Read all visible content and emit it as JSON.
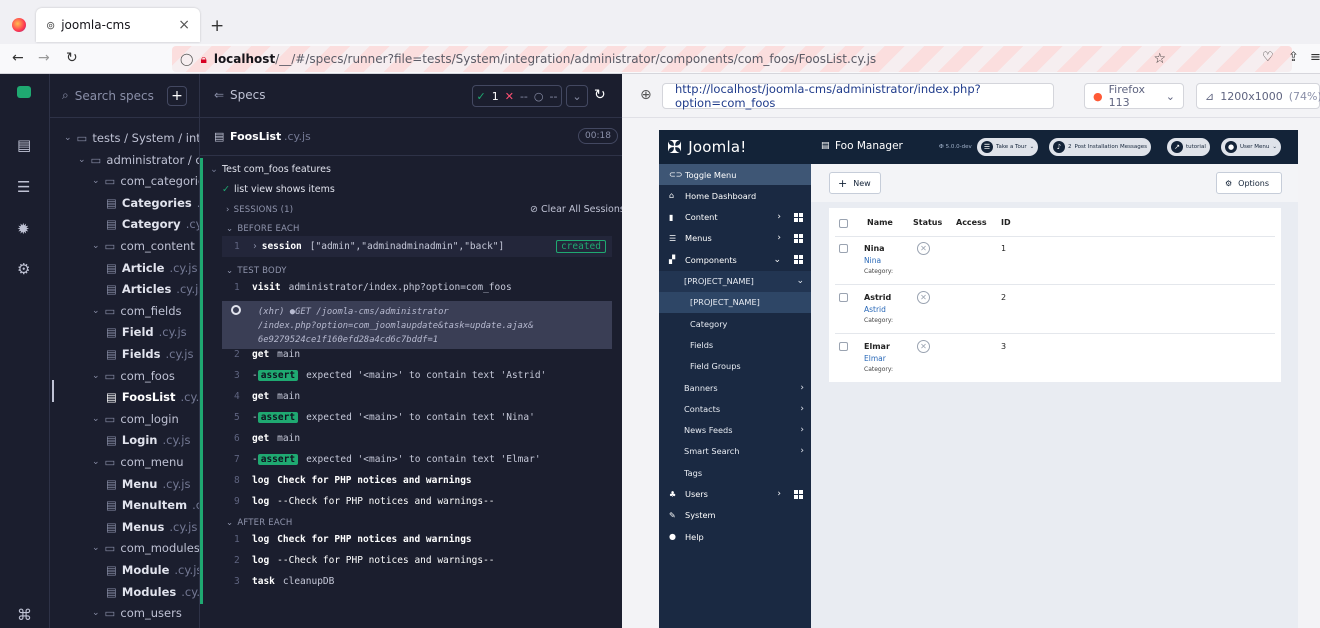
{
  "browser": {
    "tab_title": "joomla-cms",
    "tab_close": "×",
    "new_tab": "+",
    "url_host": "localhost",
    "url_path": "/__/#/specs/runner?file=tests/System/integration/administrator/components/com_foos/FoosList.cy.js"
  },
  "specs_panel": {
    "search_placeholder": "Search specs",
    "add_label": "+",
    "tree": [
      {
        "label": "tests / System / inte",
        "kind": "folder",
        "level": 0
      },
      {
        "label": "administrator / co",
        "kind": "folder",
        "level": 1
      },
      {
        "label": "com_categories",
        "kind": "folder",
        "level": 2
      },
      {
        "label": "Categories",
        "ext": ".cy.js",
        "kind": "file",
        "level": 3
      },
      {
        "label": "Category",
        "ext": ".cy.js",
        "kind": "file",
        "level": 3
      },
      {
        "label": "com_content",
        "kind": "folder",
        "level": 2
      },
      {
        "label": "Article",
        "ext": ".cy.js",
        "kind": "file",
        "level": 3
      },
      {
        "label": "Articles",
        "ext": ".cy.js",
        "kind": "file",
        "level": 3
      },
      {
        "label": "com_fields",
        "kind": "folder",
        "level": 2
      },
      {
        "label": "Field",
        "ext": ".cy.js",
        "kind": "file",
        "level": 3
      },
      {
        "label": "Fields",
        "ext": ".cy.js",
        "kind": "file",
        "level": 3
      },
      {
        "label": "com_foos",
        "kind": "folder",
        "level": 2
      },
      {
        "label": "FoosList",
        "ext": ".cy.js",
        "kind": "file",
        "level": 3,
        "active": true
      },
      {
        "label": "com_login",
        "kind": "folder",
        "level": 2
      },
      {
        "label": "Login",
        "ext": ".cy.js",
        "kind": "file",
        "level": 3
      },
      {
        "label": "com_menu",
        "kind": "folder",
        "level": 2
      },
      {
        "label": "Menu",
        "ext": ".cy.js",
        "kind": "file",
        "level": 3
      },
      {
        "label": "MenuItem",
        "ext": ".cy.js",
        "kind": "file",
        "level": 3
      },
      {
        "label": "Menus",
        "ext": ".cy.js",
        "kind": "file",
        "level": 3
      },
      {
        "label": "com_modules",
        "kind": "folder",
        "level": 2
      },
      {
        "label": "Module",
        "ext": ".cy.js",
        "kind": "file",
        "level": 3
      },
      {
        "label": "Modules",
        "ext": ".cy.js",
        "kind": "file",
        "level": 3
      },
      {
        "label": "com_users",
        "kind": "folder",
        "level": 2
      }
    ]
  },
  "reporter": {
    "title": "Specs",
    "passed": "1",
    "failed": "--",
    "pending": "--",
    "file_name": "FoosList",
    "file_ext": ".cy.js",
    "duration": "00:18",
    "suite_title": "Test com_foos features",
    "test_title": "list view shows items",
    "sessions_label": "SESSIONS (1)",
    "clear_sessions": "Clear All Sessions",
    "before_each": "BEFORE EACH",
    "session_num": "1",
    "session_cmd": "session",
    "session_args": "[\"admin\",\"adminadminadmin\",\"back\"]",
    "session_status": "created",
    "test_body": "TEST BODY",
    "cmds": [
      {
        "num": "1",
        "kw": "visit",
        "msg": "administrator/index.php?option=com_foos"
      },
      {
        "num": "2",
        "kw": "get",
        "msg": "main"
      },
      {
        "num": "3",
        "kw": "-assert",
        "msg": "expected '<main>' to contain text 'Astrid'"
      },
      {
        "num": "4",
        "kw": "get",
        "msg": "main"
      },
      {
        "num": "5",
        "kw": "-assert",
        "msg": "expected '<main>' to contain text 'Nina'"
      },
      {
        "num": "6",
        "kw": "get",
        "msg": "main"
      },
      {
        "num": "7",
        "kw": "-assert",
        "msg": "expected '<main>' to contain text 'Elmar'"
      },
      {
        "num": "8",
        "kw": "log",
        "msg": "Check for PHP notices and warnings"
      },
      {
        "num": "9",
        "kw": "log",
        "msg": "--Check for PHP notices and warnings--"
      }
    ],
    "xhr_line1": "(xhr)  ●GET /joomla-cms/administrator",
    "xhr_line2": "/index.php?option=com_joomlaupdate&task=update.ajax&",
    "xhr_line3": "6e9279524ce1f160efd28a4cd6c7bddf=1",
    "after_each": "AFTER EACH",
    "after_cmds": [
      {
        "num": "1",
        "kw": "log",
        "msg": "Check for PHP notices and warnings"
      },
      {
        "num": "2",
        "kw": "log",
        "msg": "--Check for PHP notices and warnings--"
      },
      {
        "num": "3",
        "kw": "task",
        "msg": "cleanupDB"
      }
    ]
  },
  "aut": {
    "url": "http://localhost/joomla-cms/administrator/index.php?option=com_foos",
    "browser": "Firefox 113",
    "viewport": "1200x1000",
    "zoom": "(74%)"
  },
  "joomla": {
    "logo": "Joomla!",
    "page_title": "Foo Manager",
    "version": "5.0.0-dev",
    "header_buttons": [
      "Take a Tour",
      "2",
      "Post Installation Messages",
      "tutorial",
      "User Menu"
    ],
    "menu": [
      {
        "label": "Toggle Menu",
        "kind": "top",
        "active": true
      },
      {
        "label": "Home Dashboard",
        "kind": "top"
      },
      {
        "label": "Content",
        "kind": "top",
        "chev": "›",
        "grid": true
      },
      {
        "label": "Menus",
        "kind": "top",
        "chev": "›",
        "grid": true
      },
      {
        "label": "Components",
        "kind": "top",
        "chev": "⌄",
        "grid": true
      },
      {
        "label": "[PROJECT_NAME]",
        "kind": "sub",
        "chev2": "⌄"
      },
      {
        "label": "[PROJECT_NAME]",
        "kind": "sub2"
      },
      {
        "label": "Category",
        "kind": "sub2"
      },
      {
        "label": "Fields",
        "kind": "sub2"
      },
      {
        "label": "Field Groups",
        "kind": "sub2"
      },
      {
        "label": "Banners",
        "kind": "sub",
        "chev2": "›"
      },
      {
        "label": "Contacts",
        "kind": "sub",
        "chev2": "›"
      },
      {
        "label": "News Feeds",
        "kind": "sub",
        "chev2": "›"
      },
      {
        "label": "Smart Search",
        "kind": "sub",
        "chev2": "›"
      },
      {
        "label": "Tags",
        "kind": "sub"
      },
      {
        "label": "Users",
        "kind": "top",
        "chev": "›",
        "grid": true
      },
      {
        "label": "System",
        "kind": "top"
      },
      {
        "label": "Help",
        "kind": "top"
      }
    ],
    "new_label": "New",
    "options_label": "Options",
    "columns": [
      "Name",
      "Status",
      "Access",
      "ID"
    ],
    "rows": [
      {
        "name": "Nina",
        "alias": "Nina",
        "category": "Category:",
        "id": "1"
      },
      {
        "name": "Astrid",
        "alias": "Astrid",
        "category": "Category:",
        "id": "2"
      },
      {
        "name": "Elmar",
        "alias": "Elmar",
        "category": "Category:",
        "id": "3"
      }
    ]
  },
  "colors": {
    "cypress_bg": "#1b1e2e",
    "pass_green": "#1fa971",
    "joomla_nav": "#1a2942"
  }
}
